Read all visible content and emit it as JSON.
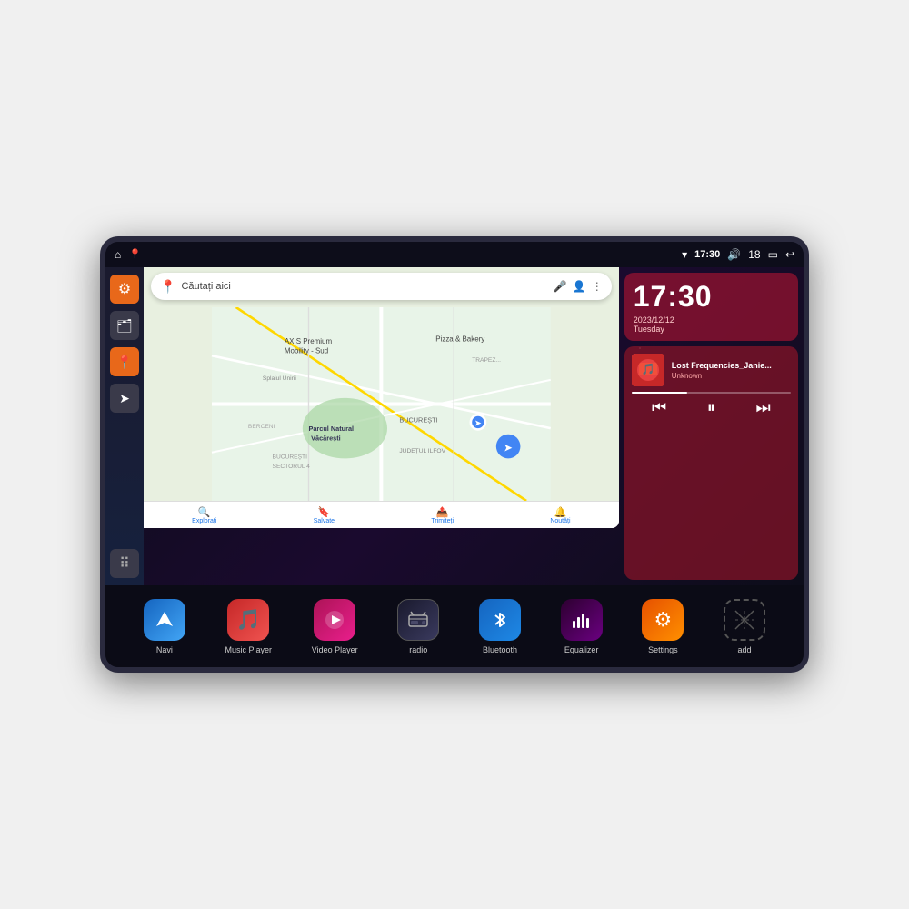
{
  "device": {
    "status_bar": {
      "left_icons": [
        "⌂",
        "📍"
      ],
      "wifi_icon": "▾",
      "time": "17:30",
      "volume_icon": "🔊",
      "battery_level": "18",
      "battery_icon": "▭",
      "back_icon": "↩"
    }
  },
  "sidebar": {
    "items": [
      {
        "id": "settings",
        "icon": "⚙",
        "color": "orange"
      },
      {
        "id": "files",
        "icon": "🗂",
        "color": "gray"
      },
      {
        "id": "maps",
        "icon": "📍",
        "color": "orange"
      },
      {
        "id": "navigation",
        "icon": "➤",
        "color": "gray"
      }
    ],
    "dots_icon": "⠿"
  },
  "map": {
    "search_placeholder": "Căutați aici",
    "bottom_items": [
      {
        "icon": "🔍",
        "label": "Explorați"
      },
      {
        "icon": "🔖",
        "label": "Salvate"
      },
      {
        "icon": "📤",
        "label": "Trimiteți"
      },
      {
        "icon": "🔔",
        "label": "Noutăți"
      }
    ],
    "places": [
      "AXIS Premium Mobility - Sud",
      "Parcul Natural Văcărești",
      "Pizza & Bakery",
      "BUCUREȘTI SECTORUL 4",
      "BUCUREȘTI",
      "JUDEȚUL ILFOV",
      "BERCENI",
      "TRAPEZULUI"
    ]
  },
  "clock": {
    "time": "17:30",
    "date": "2023/12/12",
    "day": "Tuesday"
  },
  "music": {
    "title": "Lost Frequencies_Janie...",
    "artist": "Unknown",
    "progress": 35,
    "controls": {
      "prev": "⏮",
      "pause": "⏸",
      "next": "⏭"
    }
  },
  "apps": [
    {
      "id": "navi",
      "label": "Navi",
      "icon_type": "blue-nav",
      "icon": "➤"
    },
    {
      "id": "music-player",
      "label": "Music Player",
      "icon_type": "red-music",
      "icon": "♪"
    },
    {
      "id": "video-player",
      "label": "Video Player",
      "icon_type": "pink-video",
      "icon": "▶"
    },
    {
      "id": "radio",
      "label": "radio",
      "icon_type": "dark-radio",
      "icon": "📻"
    },
    {
      "id": "bluetooth",
      "label": "Bluetooth",
      "icon_type": "blue-bt",
      "icon": "⚡"
    },
    {
      "id": "equalizer",
      "label": "Equalizer",
      "icon_type": "dark-eq",
      "icon": "🎛"
    },
    {
      "id": "settings",
      "label": "Settings",
      "icon_type": "orange-set",
      "icon": "⚙"
    },
    {
      "id": "add",
      "label": "add",
      "icon_type": "gray-add",
      "icon": "✦"
    }
  ]
}
